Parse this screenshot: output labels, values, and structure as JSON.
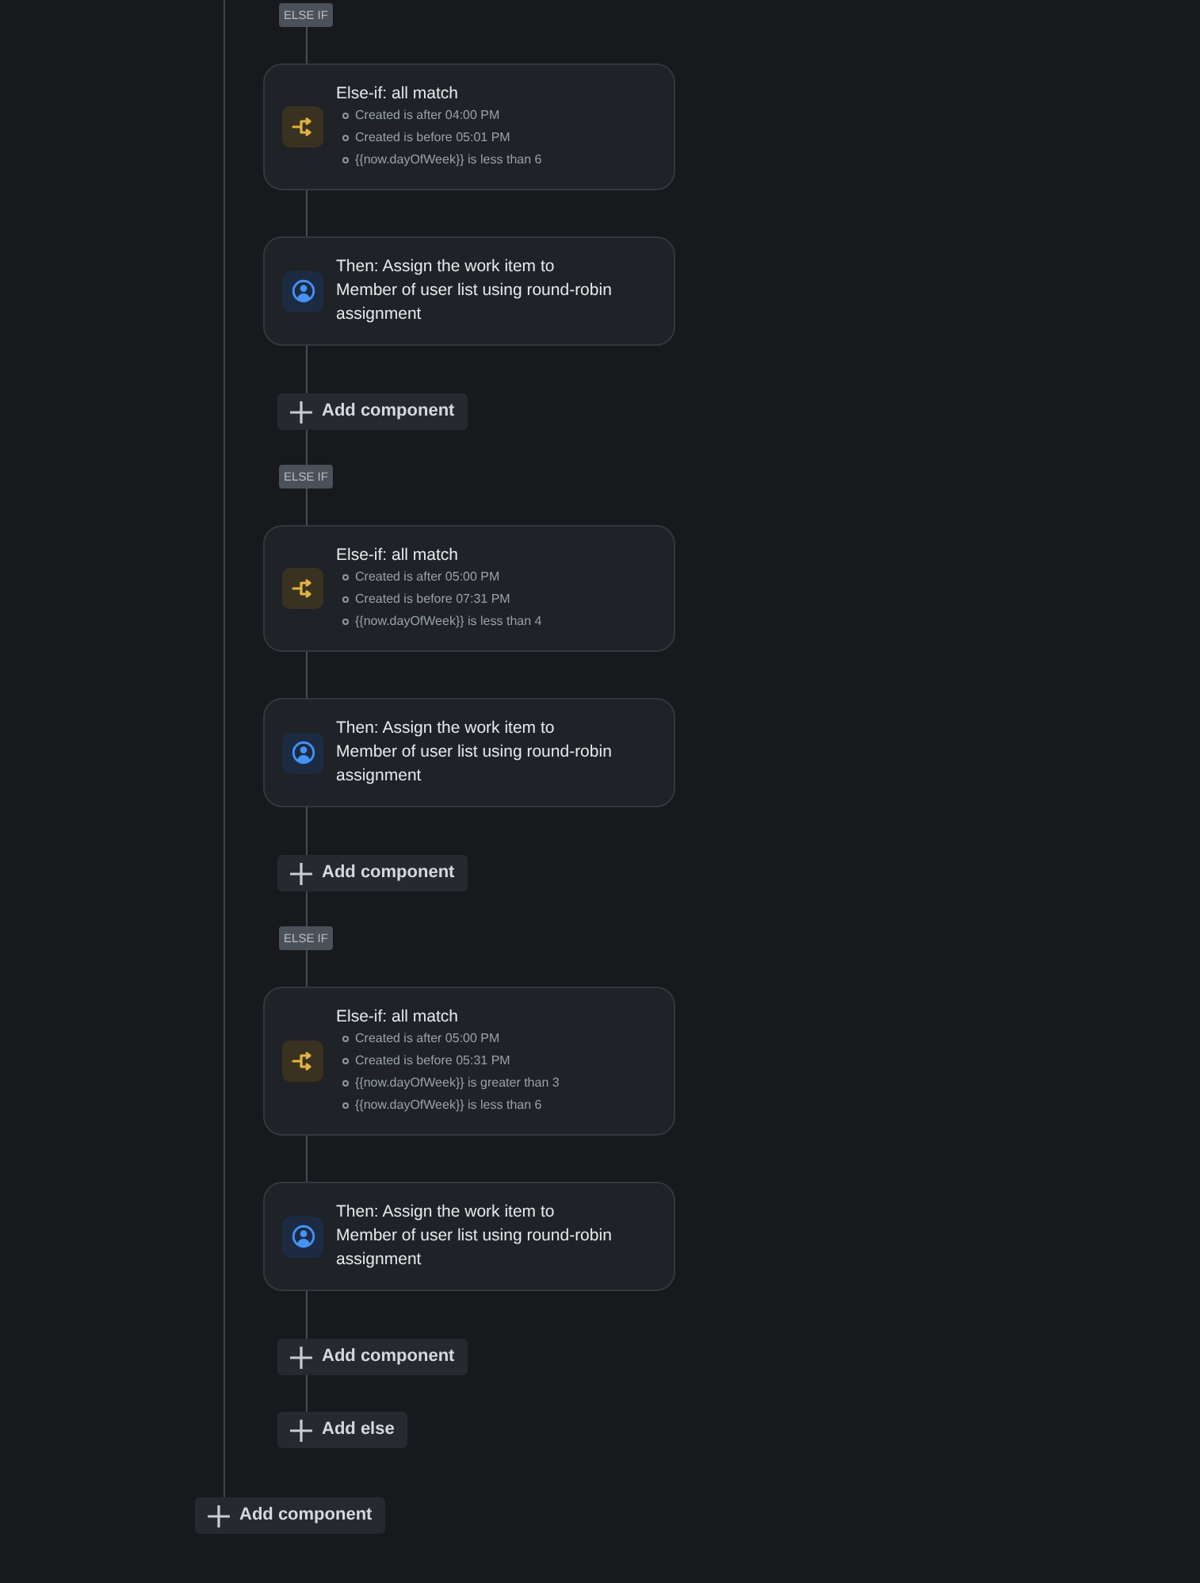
{
  "branches": [
    {
      "badge": "ELSE IF",
      "condition": {
        "title": "Else-if: all match",
        "items": [
          "Created is after 04:00 PM",
          "Created is before 05:01 PM",
          "{{now.dayOfWeek}} is less than 6"
        ]
      },
      "action": {
        "title": "Then: Assign the work item to",
        "detail": "Member of user list using round-robin assignment"
      },
      "add_button": "Add component"
    },
    {
      "badge": "ELSE IF",
      "condition": {
        "title": "Else-if: all match",
        "items": [
          "Created is after 05:00 PM",
          "Created is before 07:31 PM",
          "{{now.dayOfWeek}} is less than 4"
        ]
      },
      "action": {
        "title": "Then: Assign the work item to",
        "detail": "Member of user list using round-robin assignment"
      },
      "add_button": "Add component"
    },
    {
      "badge": "ELSE IF",
      "condition": {
        "title": "Else-if: all match",
        "items": [
          "Created is after 05:00 PM",
          "Created is before 05:31 PM",
          "{{now.dayOfWeek}} is greater than 3",
          "{{now.dayOfWeek}} is less than 6"
        ]
      },
      "action": {
        "title": "Then: Assign the work item to",
        "detail": "Member of user list using round-robin assignment"
      },
      "add_button": "Add component"
    }
  ],
  "add_else": "Add else",
  "add_component": "Add component"
}
